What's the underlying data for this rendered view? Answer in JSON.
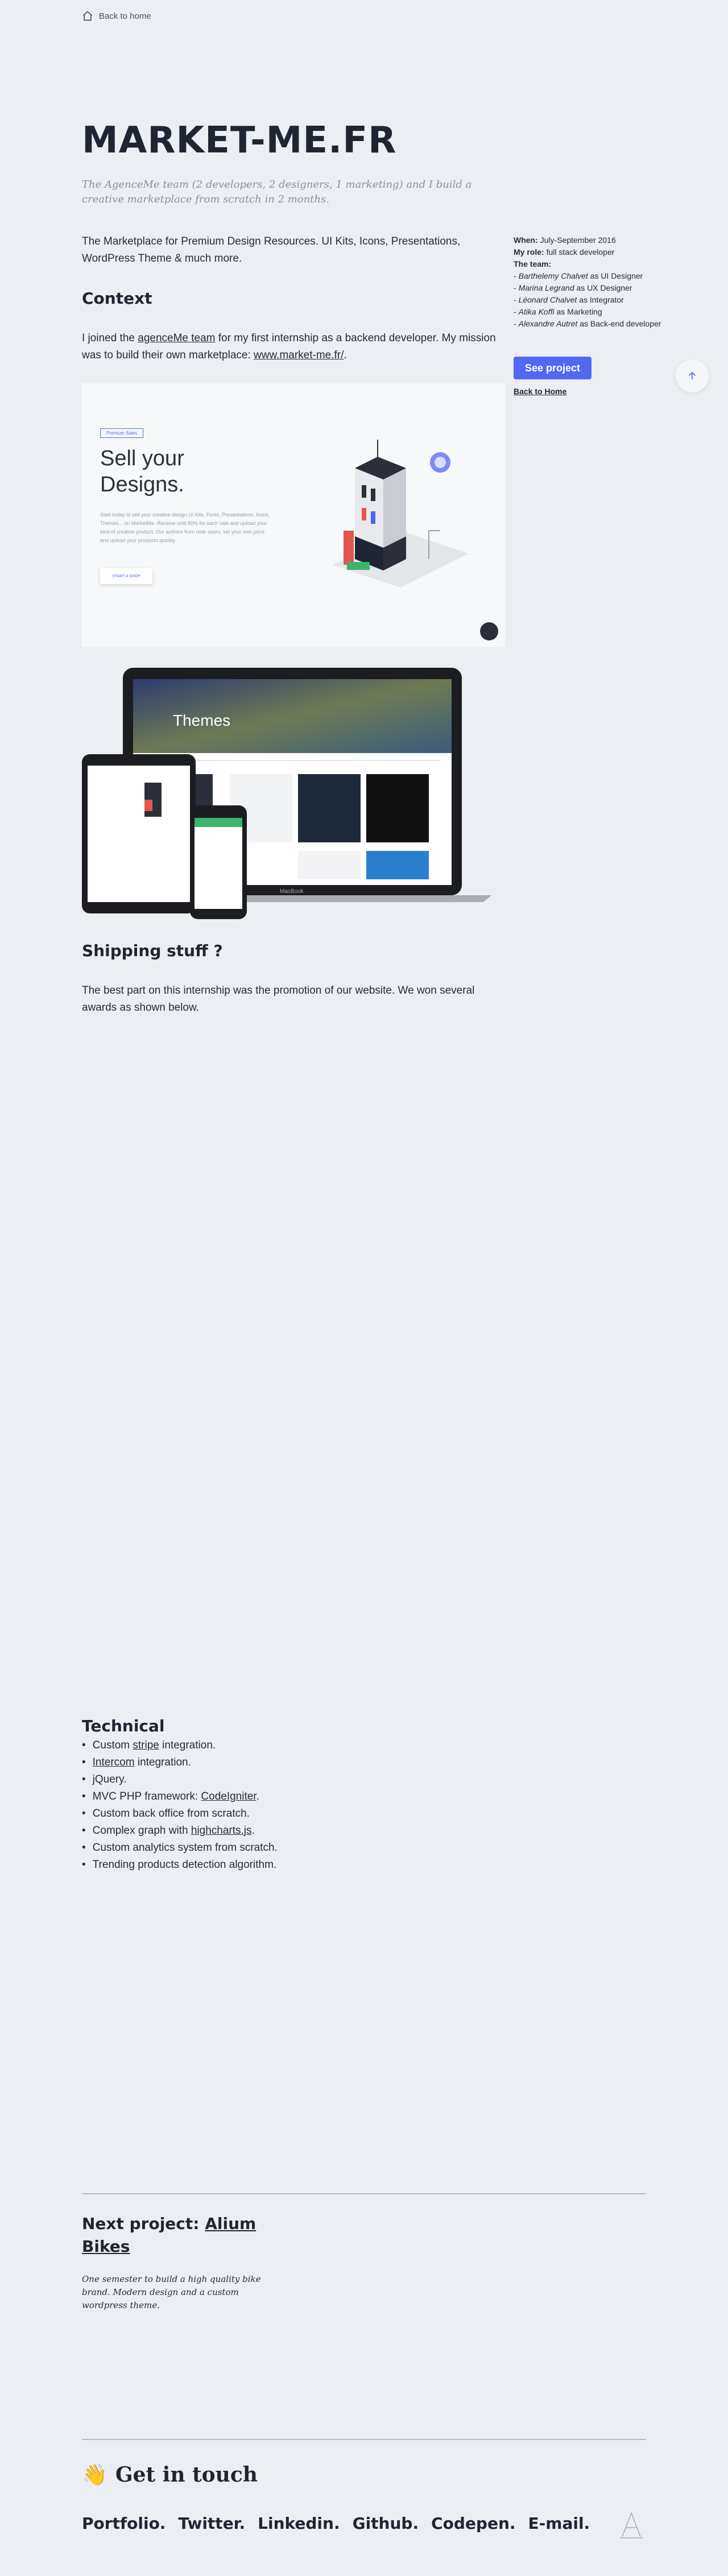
{
  "nav": {
    "back_home": "Back to home"
  },
  "hero": {
    "title": "MARKET-ME.FR",
    "subtitle": "The AgenceMe team (2 developers, 2 designers, 1 marketing) and I build a creative marketplace from scratch in 2 months."
  },
  "intro": "The Marketplace for Premium Design Resources. UI Kits, Icons, Presentations, WordPress Theme & much more.",
  "context": {
    "heading": "Context",
    "text_before": "I joined the ",
    "link1": "agenceMe team",
    "text_middle": " for my first internship as a backend developer. My mission was to build their own marketplace: ",
    "link2": "www.market-me.fr/",
    "text_after": "."
  },
  "sidebar": {
    "when_label": "When:",
    "when_value": " July-September 2016",
    "role_label": "My role:",
    "role_value": " full stack developer",
    "team_label": "The team:",
    "team": [
      {
        "name": "Barthelemy Chalvet",
        "role": " as UI Designer"
      },
      {
        "name": "Marina Legrand",
        "role": " as UX Designer"
      },
      {
        "name": "Léonard Chalvet",
        "role": " as Integrator"
      },
      {
        "name": "Atika Koffi",
        "role": " as Marketing"
      },
      {
        "name": "Alexandre Autret",
        "role": " as Back-end developer"
      }
    ],
    "see_project": "See project",
    "back_home": "Back to Home"
  },
  "screenshot": {
    "pill": "Premium Sales",
    "headline_1": "Sell your",
    "headline_2": "Designs.",
    "description": "Start today to sell your creative design UI Kits, Fonts, Presentations, Icons, Themes... on MarketMe. Receive until 80% for each sale and upload your kind of creative product. Our authors from near users, set your own price and upload your products quickly.",
    "cta": "START A SHOP"
  },
  "devices": {
    "laptop_hero_text": "Themes",
    "laptop_brand": "MacBook"
  },
  "shipping": {
    "heading": "Shipping stuff ?",
    "text": "The best part on this internship was the promotion of our website. We won several awards as shown below."
  },
  "technical": {
    "heading": "Technical",
    "items": [
      {
        "before": "Custom ",
        "link": "stripe",
        "after": " integration."
      },
      {
        "before": "",
        "link": "Intercom",
        "after": " integration."
      },
      {
        "before": "jQuery.",
        "link": "",
        "after": ""
      },
      {
        "before": "MVC PHP framework: ",
        "link": "CodeIgniter",
        "after": "."
      },
      {
        "before": "Custom back office from scratch.",
        "link": "",
        "after": ""
      },
      {
        "before": "Complex graph with ",
        "link": "highcharts.js",
        "after": "."
      },
      {
        "before": "Custom analytics system from scratch.",
        "link": "",
        "after": ""
      },
      {
        "before": "Trending products detection algorithm.",
        "link": "",
        "after": ""
      }
    ]
  },
  "next_project": {
    "label": "Next project: ",
    "link": "Alium Bikes",
    "description": "One semester to build a high quality bike brand. Modern design and a custom wordpress theme."
  },
  "get_in_touch": {
    "emoji": "👋",
    "heading": "Get in touch"
  },
  "social": [
    "Portfolio.",
    "Twitter.",
    "Linkedin.",
    "Github.",
    "Codepen.",
    "E-mail."
  ],
  "colors": {
    "accent": "#5168f3",
    "background": "#ebeef2",
    "text": "#1f2532"
  }
}
